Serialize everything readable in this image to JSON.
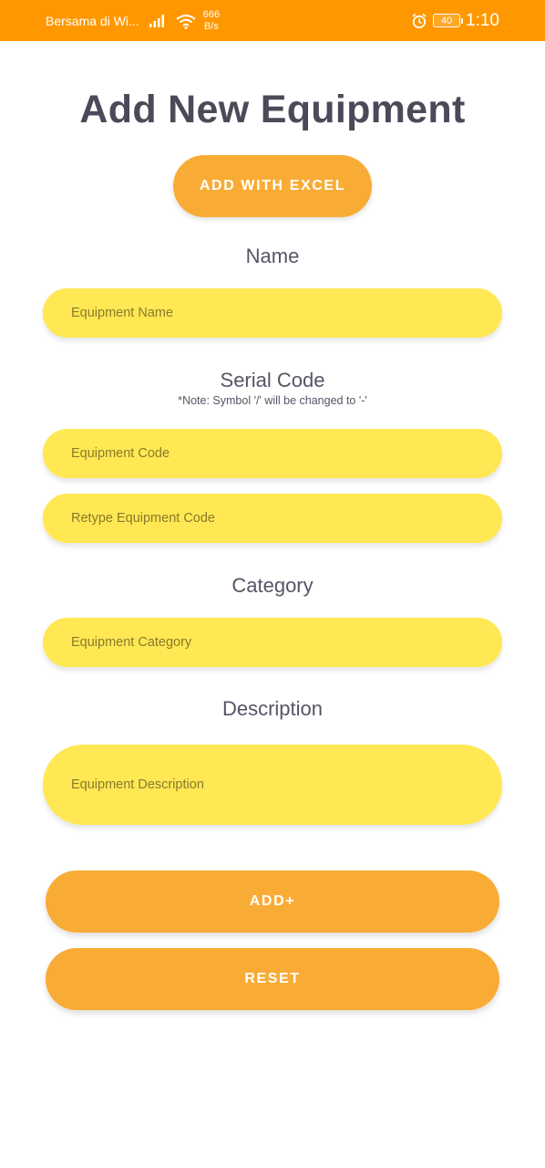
{
  "status_bar": {
    "carrier": "Bersama di Wi...",
    "netspeed_value": "666",
    "netspeed_unit": "B/s",
    "battery": "40",
    "time": "1:10"
  },
  "page": {
    "title": "Add New Equipment",
    "excel_button": "ADD WITH EXCEL"
  },
  "form": {
    "name_label": "Name",
    "name_placeholder": "Equipment Name",
    "serial_label": "Serial Code",
    "serial_note": "*Note: Symbol '/' will be changed to '-'",
    "code_placeholder": "Equipment Code",
    "retype_code_placeholder": "Retype Equipment Code",
    "category_label": "Category",
    "category_placeholder": "Equipment Category",
    "description_label": "Description",
    "description_placeholder": "Equipment Description"
  },
  "actions": {
    "add_label": "ADD+",
    "reset_label": "RESET"
  },
  "colors": {
    "status_bar": "#ff9800",
    "accent_button": "#f9ac35",
    "field_background": "#ffe853",
    "title_text": "#4a4a5a"
  }
}
